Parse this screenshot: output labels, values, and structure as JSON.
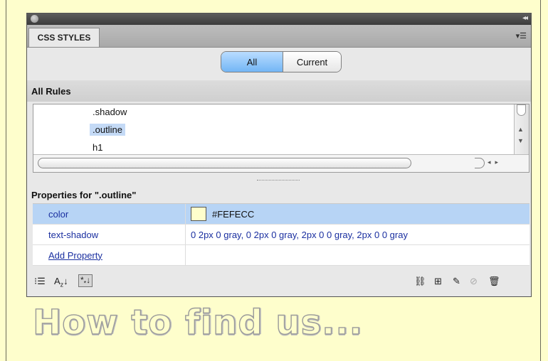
{
  "panel": {
    "tab_label": "CSS STYLES",
    "menu_icon": "panel-options-icon"
  },
  "mode_toggle": {
    "all_label": "All",
    "current_label": "Current",
    "selected": "All"
  },
  "rules": {
    "heading": "All Rules",
    "items": [
      ".shadow",
      ".outline",
      "h1"
    ],
    "selected": ".outline"
  },
  "properties": {
    "heading": "Properties for \".outline\"",
    "rows": [
      {
        "name": "color",
        "value": "#FEFECC",
        "swatch": "#FEFECC"
      },
      {
        "name": "text-shadow",
        "value": "0 2px 0 gray, 0 2px 0 gray, 2px 0 0 gray, 2px 0 0 gray"
      }
    ],
    "add_label": "Add Property"
  },
  "toolbar": {
    "left_icons": [
      "show-category-view-icon",
      "show-alphabetical-view-icon",
      "show-set-properties-icon"
    ],
    "right_icons": [
      "attach-style-sheet-icon",
      "new-css-rule-icon",
      "edit-rule-icon",
      "disable-property-icon",
      "delete-rule-icon"
    ]
  },
  "page": {
    "heading": "How to find us..."
  },
  "colors": {
    "page_background": "#FEFECC",
    "selection": "#C4DAF6",
    "active_segment": "#73B6F5"
  }
}
